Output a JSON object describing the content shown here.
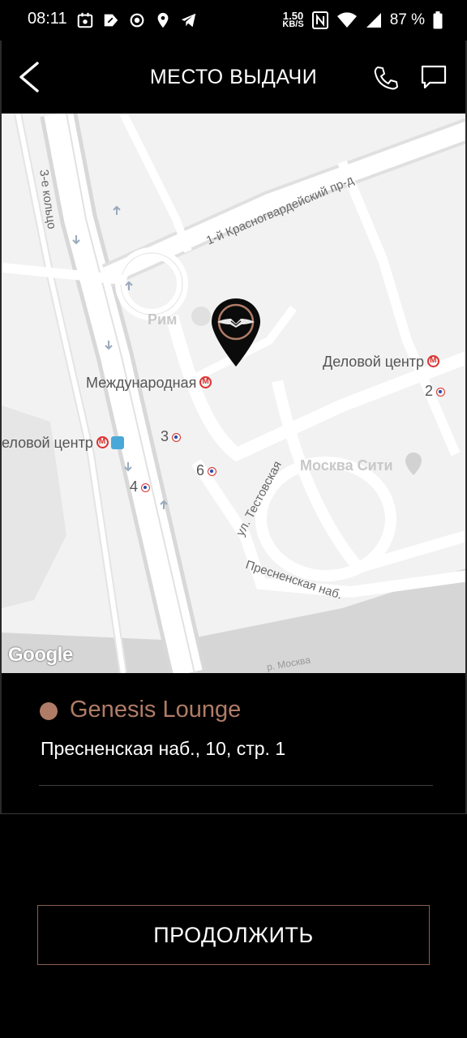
{
  "status_bar": {
    "time": "08:11",
    "net_speed_value": "1.50",
    "net_speed_unit": "KB/S",
    "battery": "87 %"
  },
  "header": {
    "title": "МЕСТО ВЫДАЧИ"
  },
  "map": {
    "labels": {
      "ring_road": "3-е кольцо",
      "krasnogvardeysky": "1-й Красногвардейский пр-д",
      "mezhdunarodnaya": "Международная",
      "delovoy_right": "Деловой центр",
      "delovoy_left": "еловой центр",
      "exit_2": "2",
      "exit_3": "3",
      "exit_4": "4",
      "exit_6": "6",
      "testovskaya": "ул. Тестовская",
      "presnenskaya": "Пресненская наб.",
      "moskva_river": "р. Москва",
      "moskva_city": "Москва Сити",
      "restaurant": "Рим"
    },
    "attribution": "Google",
    "accent_color": "#b07c67"
  },
  "location": {
    "name": "Genesis Lounge",
    "address": "Пресненская наб., 10, стр. 1"
  },
  "actions": {
    "continue_label": "ПРОДОЛЖИТЬ"
  }
}
